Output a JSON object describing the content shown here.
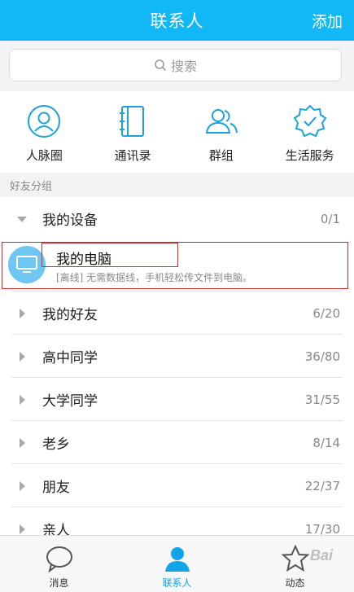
{
  "header": {
    "title": "联系人",
    "add_label": "添加"
  },
  "search": {
    "placeholder": "搜索"
  },
  "quick_actions": [
    {
      "label": "人脉圈",
      "icon": "contacts-circle-icon"
    },
    {
      "label": "通讯录",
      "icon": "address-book-icon"
    },
    {
      "label": "群组",
      "icon": "group-icon"
    },
    {
      "label": "生活服务",
      "icon": "life-service-icon"
    }
  ],
  "section_label": "好友分组",
  "groups": [
    {
      "name": "我的设备",
      "count": "0/1",
      "expanded": true
    },
    {
      "name": "我的好友",
      "count": "6/20",
      "expanded": false
    },
    {
      "name": "高中同学",
      "count": "36/80",
      "expanded": false
    },
    {
      "name": "大学同学",
      "count": "31/55",
      "expanded": false
    },
    {
      "name": "老乡",
      "count": "8/14",
      "expanded": false
    },
    {
      "name": "朋友",
      "count": "22/37",
      "expanded": false
    },
    {
      "name": "亲人",
      "count": "17/30",
      "expanded": false
    }
  ],
  "device": {
    "name": "我的电脑",
    "description": "[离线] 无需数据线，手机轻松传文件到电脑。",
    "icon": "monitor-icon"
  },
  "tabs": [
    {
      "label": "消息",
      "icon": "chat-bubble-icon",
      "active": false
    },
    {
      "label": "联系人",
      "icon": "person-icon",
      "active": true
    },
    {
      "label": "动态",
      "icon": "star-icon",
      "active": false
    }
  ],
  "colors": {
    "brand": "#12b7f5",
    "highlight_box": "#cc2b2b",
    "icon_blue": "#1aa3d9"
  },
  "watermark": "Bai"
}
